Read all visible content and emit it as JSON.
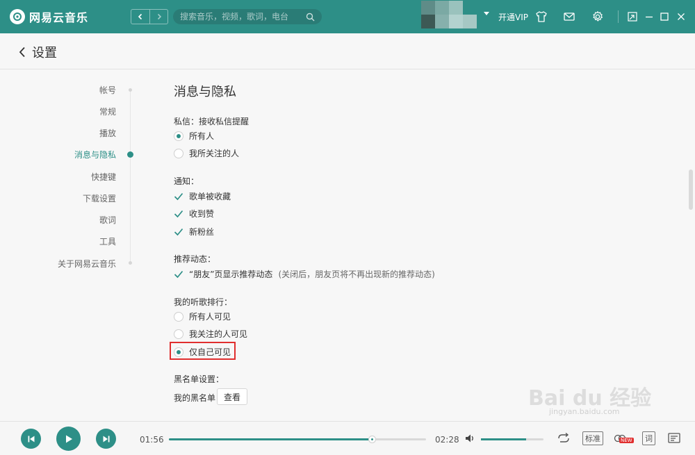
{
  "app": {
    "title": "网易云音乐"
  },
  "search": {
    "placeholder": "搜索音乐，视频，歌词，电台"
  },
  "topbar": {
    "vip_label": "开通VIP"
  },
  "header": {
    "title": "设置"
  },
  "sidebar": {
    "items": [
      {
        "label": "帐号"
      },
      {
        "label": "常规"
      },
      {
        "label": "播放"
      },
      {
        "label": "消息与隐私",
        "active": true
      },
      {
        "label": "快捷键"
      },
      {
        "label": "下载设置"
      },
      {
        "label": "歌词"
      },
      {
        "label": "工具"
      },
      {
        "label": "关于网易云音乐"
      }
    ]
  },
  "privacy": {
    "section_title": "消息与隐私",
    "dm": {
      "label": "私信：接收私信提醒",
      "options": [
        {
          "label": "所有人",
          "selected": true
        },
        {
          "label": "我所关注的人",
          "selected": false
        }
      ]
    },
    "notify": {
      "label": "通知：",
      "options": [
        {
          "label": "歌单被收藏",
          "checked": true
        },
        {
          "label": "收到赞",
          "checked": true
        },
        {
          "label": "新粉丝",
          "checked": true
        }
      ]
    },
    "recommend": {
      "label": "推荐动态：",
      "option": "“朋友”页显示推荐动态",
      "note": "(关闭后，朋友页将不再出现新的推荐动态)",
      "checked": true
    },
    "ranking": {
      "label": "我的听歌排行：",
      "options": [
        {
          "label": "所有人可见",
          "selected": false
        },
        {
          "label": "我关注的人可见",
          "selected": false
        },
        {
          "label": "仅自己可见",
          "selected": true
        }
      ]
    },
    "blacklist": {
      "label": "黑名单设置：",
      "text": "我的黑名单",
      "button": "查看"
    }
  },
  "player": {
    "current_time": "01:56",
    "total_time": "02:28",
    "progress": 0.788,
    "volume": 0.72,
    "quality_label": "标准",
    "lyrics_label": "词",
    "new_badge": "NEW"
  },
  "watermark": {
    "main": "Bai du 经验",
    "sub": "jingyan.baidu.com"
  },
  "colors": {
    "accent": "#2d8f87",
    "highlight": "#e02e2e"
  }
}
